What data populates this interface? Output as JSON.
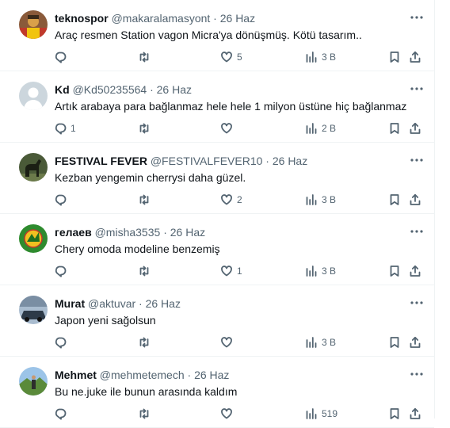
{
  "tweets": [
    {
      "name": "teknospor",
      "handle": "@makaralamasyont",
      "date": "26 Haz",
      "text": "Araç resmen Station vagon Micra'ya dönüşmüş. Kötü tasarım..",
      "replies": "",
      "likes": "5",
      "views": "3 B",
      "avatar": {
        "bg": "#8a5a3a",
        "fg": "#d9a04a",
        "kind": "person"
      }
    },
    {
      "name": "Kd",
      "handle": "@Kd50235564",
      "date": "26 Haz",
      "text": "Artık arabaya para bağlanmaz hele hele 1 milyon üstüne hiç bağlanmaz",
      "replies": "1",
      "likes": "",
      "views": "2 B",
      "avatar": {
        "bg": "#ccd6dd",
        "fg": "#ffffff",
        "kind": "default"
      }
    },
    {
      "name": "FESTIVAL FEVER",
      "handle": "@FESTIVALFEVER10",
      "date": "26 Haz",
      "text": "Kezban yengemin cherrysi daha güzel.",
      "replies": "",
      "likes": "2",
      "views": "3 B",
      "avatar": {
        "bg": "#3d4a2e",
        "fg": "#1b1f14",
        "kind": "horse"
      }
    },
    {
      "name": "гелаев",
      "handle": "@misha3535",
      "date": "26 Haz",
      "text": "Chery omoda modeline benzemiş",
      "replies": "",
      "likes": "1",
      "views": "3 B",
      "avatar": {
        "bg": "#2e8b2e",
        "fg": "#f0c020",
        "kind": "emblem"
      }
    },
    {
      "name": "Murat",
      "handle": "@aktuvar",
      "date": "26 Haz",
      "text": "Japon yeni sağolsun",
      "replies": "",
      "likes": "",
      "views": "3 B",
      "avatar": {
        "bg": "#8fa3b8",
        "fg": "#2d3a48",
        "kind": "car"
      }
    },
    {
      "name": "Mehmet",
      "handle": "@mehmetemech",
      "date": "26 Haz",
      "text": "Bu ne.juke ile bunun arasında kaldım",
      "replies": "",
      "likes": "",
      "views": "519",
      "avatar": {
        "bg": "#9cc4e8",
        "fg": "#5a8a3a",
        "kind": "landscape"
      }
    }
  ],
  "icons": {
    "reply": "reply-icon",
    "retweet": "retweet-icon",
    "like": "heart-icon",
    "views": "views-icon",
    "bookmark": "bookmark-icon",
    "share": "share-icon",
    "more": "more-icon"
  },
  "colors": {
    "text": "#0f1419",
    "secondary": "#536471",
    "border": "#eff3f4"
  }
}
